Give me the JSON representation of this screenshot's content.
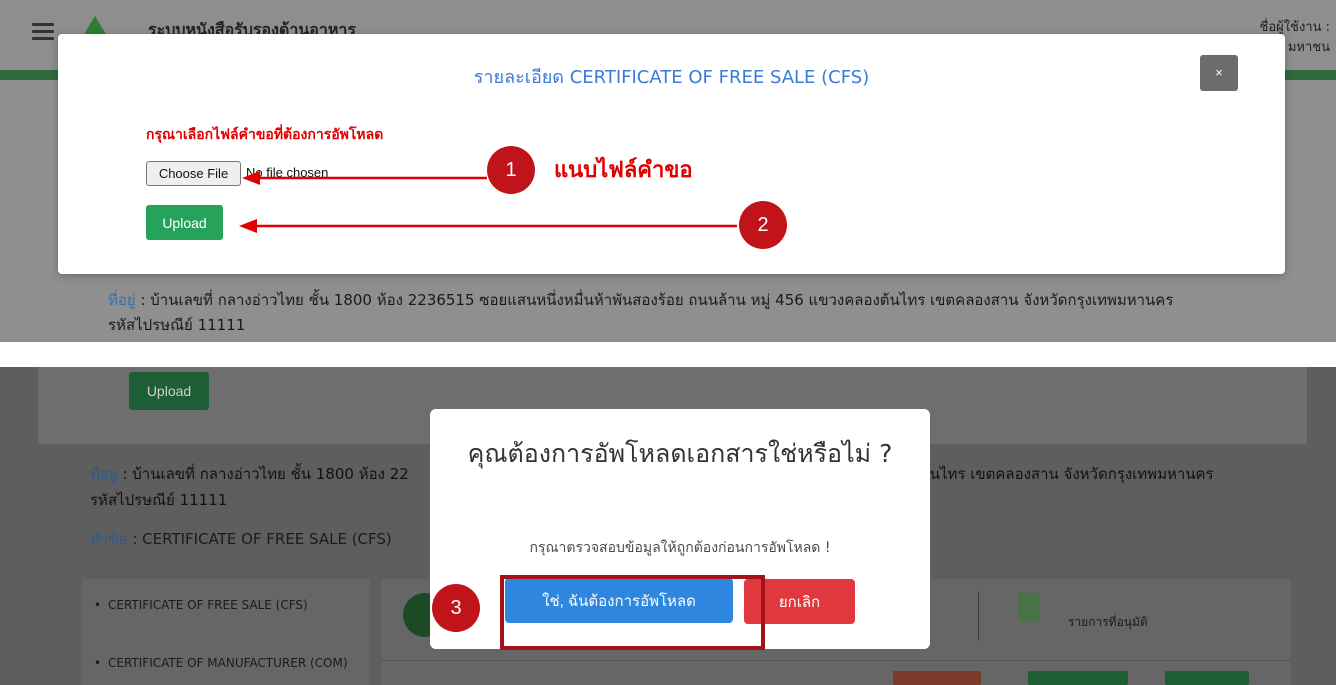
{
  "top_page": {
    "site_title": "ระบบหนังสือรับรองด้านอาหาร",
    "user_label_line1": "ชื่อผู้ใช้งาน :",
    "user_label_line2": "มหาชน",
    "address_key": "ที่อยู่",
    "address_value": " : บ้านเลขที่ กลางอ่าวไทย ชั้น 1800 ห้อง 2236515 ซอยแสนหนึ่งหมื่นห้าพันสองร้อย ถนนล้าน หมู่ 456 แขวงคลองต้นไทร เขตคลองสาน จังหวัดกรุงเทพมหานคร",
    "postal": "รหัสไปรษณีย์ 11111"
  },
  "upload_modal": {
    "title": "รายละเอียด CERTIFICATE OF FREE SALE (CFS)",
    "close_label": "×",
    "instruction": "กรุณาเลือกไฟล์คำขอที่ต้องการอัพโหลด",
    "choose_file_label": "Choose File",
    "no_file_text": "No file chosen",
    "upload_label": "Upload"
  },
  "annotations": {
    "step1": "1",
    "step1_text": "แนบไฟล์คำขอ",
    "step2": "2",
    "step3": "3",
    "arrow_color": "#e00000",
    "marker_color": "#c0141a"
  },
  "bottom_page": {
    "upload_label": "Upload",
    "address_key": "ที่อยู่",
    "address_value": " : บ้านเลขที่ กลางอ่าวไทย ชั้น 1800 ห้อง 22",
    "address_tail": "ต้นไทร เขตคลองสาน จังหวัดกรุงเทพมหานคร",
    "postal": "รหัสไปรษณีย์ 11111",
    "topic_key": "หัวข้อ",
    "topic_value": " : CERTIFICATE OF FREE SALE (CFS)",
    "sidebar_items": [
      "CERTIFICATE OF FREE SALE (CFS)",
      "CERTIFICATE OF MANUFACTURER (COM)"
    ],
    "approved_label": "รายการที่อนุมัติ"
  },
  "confirm_dialog": {
    "title": "คุณต้องการอัพโหลดเอกสารใช่หรือไม่ ?",
    "message": "กรุณาตรวจสอบข้อมูลให้ถูกต้องก่อนการอัพโหลด !",
    "confirm_label": "ใช่, ฉันต้องการอัพโหลด",
    "cancel_label": "ยกเลิก"
  },
  "colors": {
    "accent_blue": "#3a7bd5",
    "upload_green": "#27a25b",
    "confirm_blue": "#2e86de",
    "cancel_red": "#e0383e",
    "instruction_red": "#e00000"
  }
}
